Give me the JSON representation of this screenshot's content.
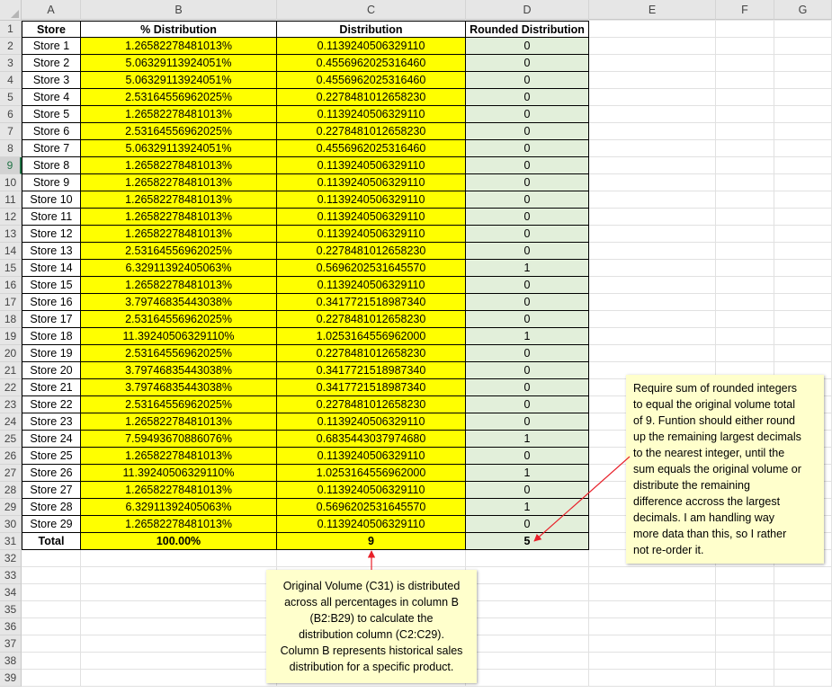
{
  "columns": [
    "A",
    "B",
    "C",
    "D",
    "E",
    "F",
    "G"
  ],
  "row_numbers": [
    "1",
    "2",
    "3",
    "4",
    "5",
    "6",
    "7",
    "8",
    "9",
    "10",
    "11",
    "12",
    "13",
    "14",
    "15",
    "16",
    "17",
    "18",
    "19",
    "20",
    "21",
    "22",
    "23",
    "24",
    "25",
    "26",
    "27",
    "28",
    "29",
    "30",
    "31",
    "32",
    "33",
    "34",
    "35",
    "36",
    "37",
    "38",
    "39"
  ],
  "selected_row": "9",
  "headers": {
    "a": "Store",
    "b": "% Distribution",
    "c": "Distribution",
    "d": "Rounded Distribution"
  },
  "rows": [
    {
      "store": "Store 1",
      "pct": "1.26582278481013%",
      "dist": "0.1139240506329110",
      "rounded": "0"
    },
    {
      "store": "Store 2",
      "pct": "5.06329113924051%",
      "dist": "0.4556962025316460",
      "rounded": "0"
    },
    {
      "store": "Store 3",
      "pct": "5.06329113924051%",
      "dist": "0.4556962025316460",
      "rounded": "0"
    },
    {
      "store": "Store 4",
      "pct": "2.53164556962025%",
      "dist": "0.2278481012658230",
      "rounded": "0"
    },
    {
      "store": "Store 5",
      "pct": "1.26582278481013%",
      "dist": "0.1139240506329110",
      "rounded": "0"
    },
    {
      "store": "Store 6",
      "pct": "2.53164556962025%",
      "dist": "0.2278481012658230",
      "rounded": "0"
    },
    {
      "store": "Store 7",
      "pct": "5.06329113924051%",
      "dist": "0.4556962025316460",
      "rounded": "0"
    },
    {
      "store": "Store 8",
      "pct": "1.26582278481013%",
      "dist": "0.1139240506329110",
      "rounded": "0"
    },
    {
      "store": "Store 9",
      "pct": "1.26582278481013%",
      "dist": "0.1139240506329110",
      "rounded": "0"
    },
    {
      "store": "Store 10",
      "pct": "1.26582278481013%",
      "dist": "0.1139240506329110",
      "rounded": "0"
    },
    {
      "store": "Store 11",
      "pct": "1.26582278481013%",
      "dist": "0.1139240506329110",
      "rounded": "0"
    },
    {
      "store": "Store 12",
      "pct": "1.26582278481013%",
      "dist": "0.1139240506329110",
      "rounded": "0"
    },
    {
      "store": "Store 13",
      "pct": "2.53164556962025%",
      "dist": "0.2278481012658230",
      "rounded": "0"
    },
    {
      "store": "Store 14",
      "pct": "6.32911392405063%",
      "dist": "0.5696202531645570",
      "rounded": "1"
    },
    {
      "store": "Store 15",
      "pct": "1.26582278481013%",
      "dist": "0.1139240506329110",
      "rounded": "0"
    },
    {
      "store": "Store 16",
      "pct": "3.79746835443038%",
      "dist": "0.3417721518987340",
      "rounded": "0"
    },
    {
      "store": "Store 17",
      "pct": "2.53164556962025%",
      "dist": "0.2278481012658230",
      "rounded": "0"
    },
    {
      "store": "Store 18",
      "pct": "11.39240506329110%",
      "dist": "1.0253164556962000",
      "rounded": "1"
    },
    {
      "store": "Store 19",
      "pct": "2.53164556962025%",
      "dist": "0.2278481012658230",
      "rounded": "0"
    },
    {
      "store": "Store 20",
      "pct": "3.79746835443038%",
      "dist": "0.3417721518987340",
      "rounded": "0"
    },
    {
      "store": "Store 21",
      "pct": "3.79746835443038%",
      "dist": "0.3417721518987340",
      "rounded": "0"
    },
    {
      "store": "Store 22",
      "pct": "2.53164556962025%",
      "dist": "0.2278481012658230",
      "rounded": "0"
    },
    {
      "store": "Store 23",
      "pct": "1.26582278481013%",
      "dist": "0.1139240506329110",
      "rounded": "0"
    },
    {
      "store": "Store 24",
      "pct": "7.59493670886076%",
      "dist": "0.6835443037974680",
      "rounded": "1"
    },
    {
      "store": "Store 25",
      "pct": "1.26582278481013%",
      "dist": "0.1139240506329110",
      "rounded": "0"
    },
    {
      "store": "Store 26",
      "pct": "11.39240506329110%",
      "dist": "1.0253164556962000",
      "rounded": "1"
    },
    {
      "store": "Store 27",
      "pct": "1.26582278481013%",
      "dist": "0.1139240506329110",
      "rounded": "0"
    },
    {
      "store": "Store 28",
      "pct": "6.32911392405063%",
      "dist": "0.5696202531645570",
      "rounded": "1"
    },
    {
      "store": "Store 29",
      "pct": "1.26582278481013%",
      "dist": "0.1139240506329110",
      "rounded": "0"
    }
  ],
  "total": {
    "label": "Total",
    "pct": "100.00%",
    "dist": "9",
    "rounded": "5"
  },
  "notes": {
    "bottom": [
      "Original Volume (C31) is distributed",
      "across all percentages in column B",
      "(B2:B29) to calculate the",
      "distribution column (C2:C29).",
      "Column B represents historical sales",
      "distribution for a specific product."
    ],
    "right": [
      "Require sum of rounded integers",
      "to equal the original volume total",
      "of 9.  Funtion should either round",
      "up the remaining largest decimals",
      "to the nearest integer, until the",
      "sum equals the original volume or",
      "distribute the remaining",
      "difference accross the largest",
      "decimals.  I am handling way",
      "more data than this, so I rather",
      "not re-order it."
    ]
  },
  "colors": {
    "yellow": "#ffff00",
    "green": "#e2efda",
    "note": "#ffffcc",
    "arrow": "#e8202a",
    "selected": "#217346"
  }
}
